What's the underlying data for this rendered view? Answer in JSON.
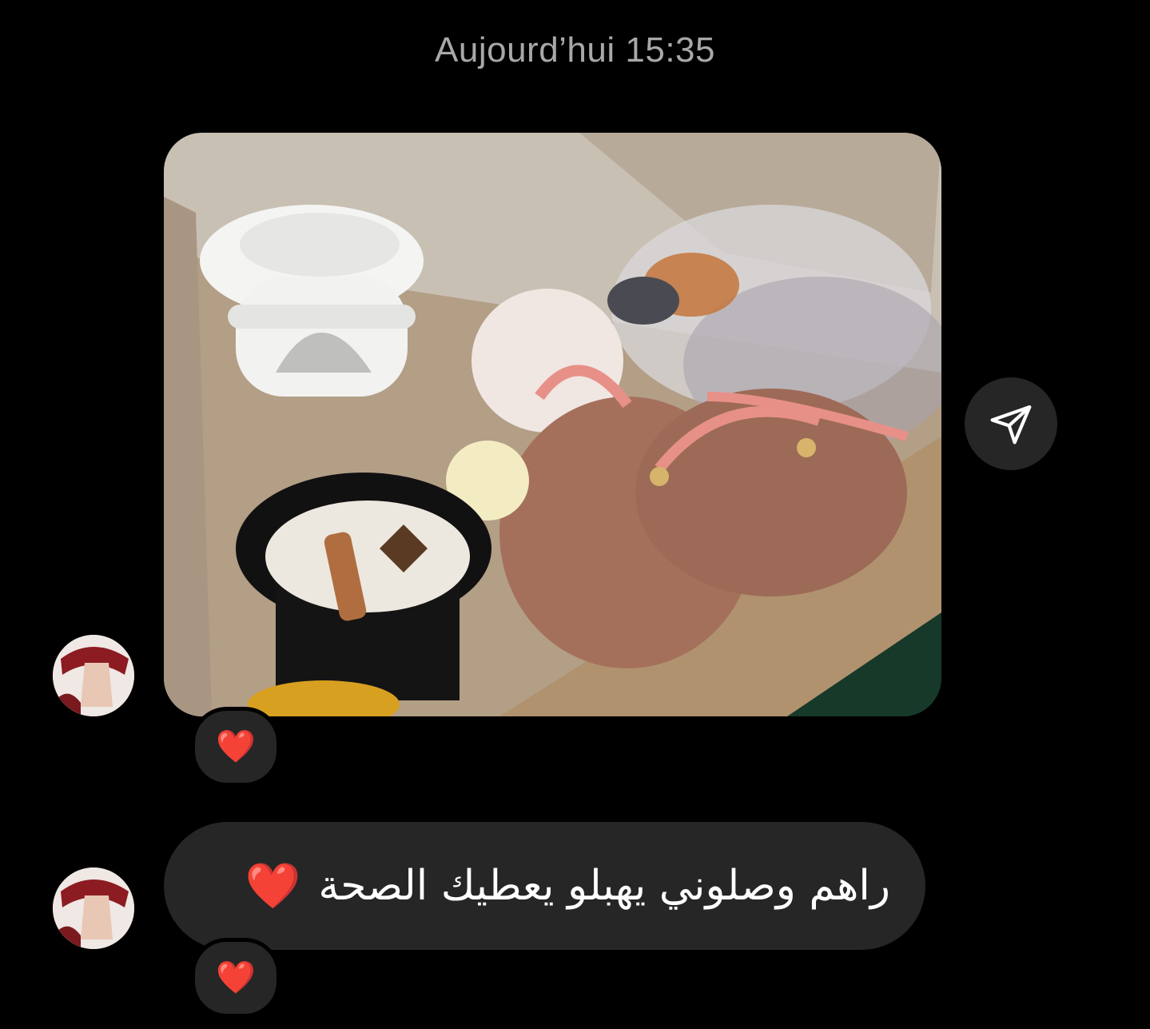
{
  "header": {
    "timestamp": "Aujourd’hui 15:35"
  },
  "messages": [
    {
      "type": "photo",
      "description_icon": "gift-box-photo",
      "reaction": "❤️"
    },
    {
      "type": "text",
      "text": "راهم وصلوني يهبلو يعطيك الصحة",
      "emoji": "❤️",
      "reaction": "❤️"
    }
  ],
  "colors": {
    "background": "#000000",
    "bubble": "#262626",
    "timestamp": "#a8a8a8",
    "heart": "#e8202f"
  },
  "icons": {
    "share": "paper-plane-icon",
    "heart": "heart-icon",
    "avatar": "user-avatar"
  }
}
